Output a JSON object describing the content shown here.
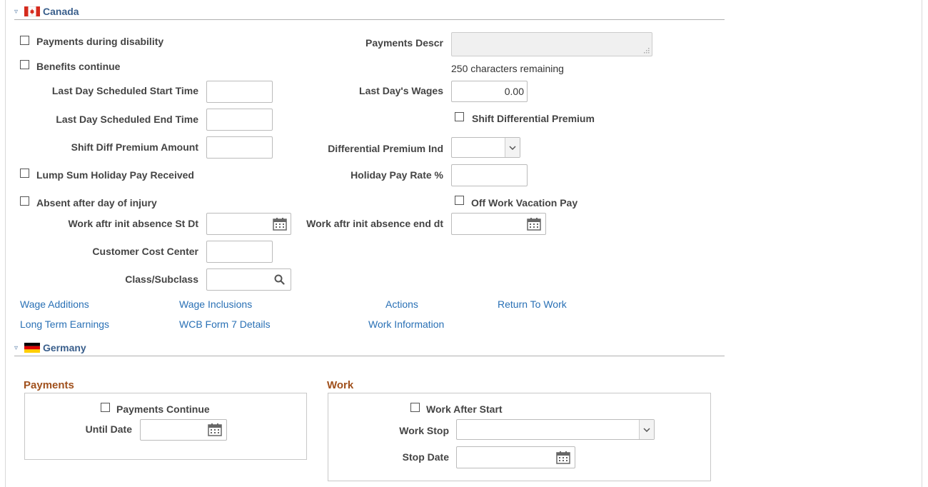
{
  "canada": {
    "title": "Canada",
    "payments_during_disability": "Payments during disability",
    "benefits_continue": "Benefits continue",
    "last_day_sched_start": "Last Day Scheduled Start Time",
    "last_day_sched_end": "Last Day Scheduled End Time",
    "shift_diff_premium_amount": "Shift Diff Premium Amount",
    "lump_sum_holiday": "Lump Sum Holiday Pay Received",
    "absent_after_injury": "Absent after day of injury",
    "work_aftr_init_st": "Work aftr init absence St Dt",
    "customer_cost_center": "Customer Cost Center",
    "class_subclass": "Class/Subclass",
    "payments_descr": "Payments Descr",
    "chars_remaining": "250 characters remaining",
    "last_days_wages": "Last Day's Wages",
    "last_days_wages_value": "0.00",
    "shift_diff_premium": "Shift Differential Premium",
    "diff_premium_ind": "Differential Premium Ind",
    "holiday_pay_rate": "Holiday Pay Rate %",
    "off_work_vacation": "Off Work Vacation Pay",
    "work_aftr_init_end": "Work aftr init absence end dt",
    "links": {
      "wage_additions": "Wage Additions",
      "wage_inclusions": "Wage Inclusions",
      "actions": "Actions",
      "return_to_work": "Return To Work",
      "long_term_earnings": "Long Term Earnings",
      "wcb_form7": "WCB Form 7 Details",
      "work_information": "Work Information"
    }
  },
  "germany": {
    "title": "Germany",
    "payments_group": "Payments",
    "payments_continue": "Payments Continue",
    "until_date": "Until Date",
    "work_group": "Work",
    "work_after_start": "Work After Start",
    "work_stop": "Work Stop",
    "stop_date": "Stop Date"
  },
  "colors": {
    "link": "#2970b5",
    "section_title": "#3a5f8c",
    "group_title": "#a0501c"
  }
}
